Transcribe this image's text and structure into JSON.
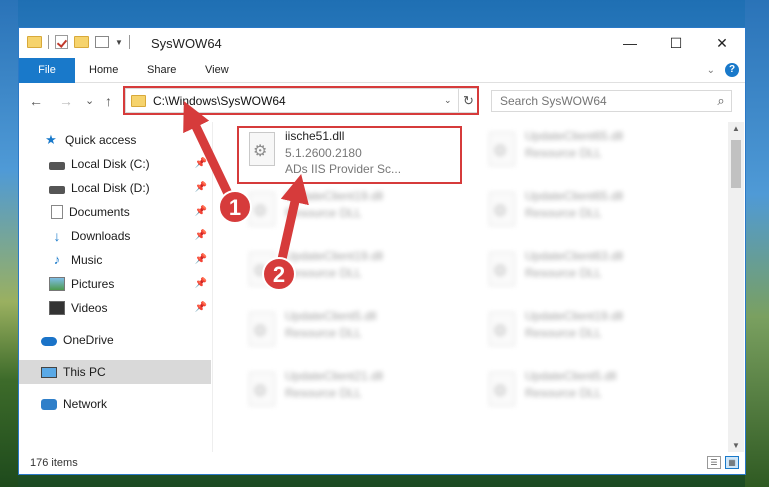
{
  "window": {
    "title": "SysWOW64",
    "controls": {
      "minimize": "—",
      "maximize": "☐",
      "close": "✕"
    }
  },
  "ribbon": {
    "tabs": [
      "File",
      "Home",
      "Share",
      "View"
    ],
    "expand_icon": "chevron-down-icon",
    "help_label": "?"
  },
  "navigation": {
    "back_icon": "←",
    "forward_icon": "→",
    "recent_icon": "⌄",
    "up_icon": "↑",
    "address_path": "C:\\Windows\\SysWOW64",
    "refresh_icon": "↻",
    "search_placeholder": "Search SysWOW64"
  },
  "sidebar": {
    "items": [
      {
        "label": "Quick access",
        "icon": "star-icon",
        "pinned": false
      },
      {
        "label": "Local Disk (C:)",
        "icon": "disk-icon",
        "pinned": true
      },
      {
        "label": "Local Disk (D:)",
        "icon": "disk-icon",
        "pinned": true
      },
      {
        "label": "Documents",
        "icon": "document-icon",
        "pinned": true
      },
      {
        "label": "Downloads",
        "icon": "download-icon",
        "pinned": true
      },
      {
        "label": "Music",
        "icon": "music-icon",
        "pinned": true
      },
      {
        "label": "Pictures",
        "icon": "pictures-icon",
        "pinned": true
      },
      {
        "label": "Videos",
        "icon": "videos-icon",
        "pinned": true
      },
      {
        "label": "OneDrive",
        "icon": "cloud-icon",
        "pinned": false
      },
      {
        "label": "This PC",
        "icon": "pc-icon",
        "pinned": false,
        "selected": true
      },
      {
        "label": "Network",
        "icon": "network-icon",
        "pinned": false
      }
    ]
  },
  "files": {
    "highlighted": {
      "name": "iische51.dll",
      "version": "5.1.2600.2180",
      "description": "ADs IIS Provider Sc..."
    },
    "blurred": [
      {
        "name": "UpdateClient65.dll",
        "description": "Resource DLL"
      },
      {
        "name": "UpdateClient19.dll",
        "description": "Resource DLL"
      },
      {
        "name": "UpdateClient65.dll",
        "description": "Resource DLL"
      },
      {
        "name": "UpdateClient19.dll",
        "description": "Resource DLL"
      },
      {
        "name": "UpdateClient63.dll",
        "description": "Resource DLL"
      },
      {
        "name": "UpdateClient5.dll",
        "description": "Resource DLL"
      },
      {
        "name": "UpdateClient19.dll",
        "description": "Resource DLL"
      },
      {
        "name": "UpdateClient21.dll",
        "description": "Resource DLL"
      },
      {
        "name": "UpdateClient5.dll",
        "description": "Resource DLL"
      }
    ]
  },
  "annotations": {
    "step1": "1",
    "step2": "2",
    "color": "#d63b3b"
  },
  "status": {
    "item_count": "176 items"
  },
  "colors": {
    "accent": "#1979ca",
    "highlight_red": "#d63b3b"
  }
}
